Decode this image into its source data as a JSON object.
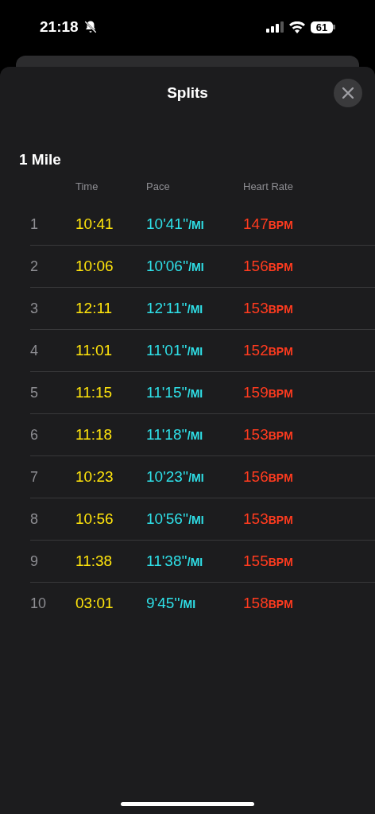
{
  "status_bar": {
    "time": "21:18",
    "battery": "61"
  },
  "sheet": {
    "title": "Splits"
  },
  "section": {
    "title": "1 Mile",
    "columns": [
      "Time",
      "Pace",
      "Heart Rate"
    ]
  },
  "splits": [
    {
      "index": "1",
      "time": "10:41",
      "pace": "10'41''",
      "pace_unit": "/MI",
      "heart_rate": "147",
      "hr_unit": "BPM"
    },
    {
      "index": "2",
      "time": "10:06",
      "pace": "10'06''",
      "pace_unit": "/MI",
      "heart_rate": "156",
      "hr_unit": "BPM"
    },
    {
      "index": "3",
      "time": "12:11",
      "pace": "12'11''",
      "pace_unit": "/MI",
      "heart_rate": "153",
      "hr_unit": "BPM"
    },
    {
      "index": "4",
      "time": "11:01",
      "pace": "11'01''",
      "pace_unit": "/MI",
      "heart_rate": "152",
      "hr_unit": "BPM"
    },
    {
      "index": "5",
      "time": "11:15",
      "pace": "11'15''",
      "pace_unit": "/MI",
      "heart_rate": "159",
      "hr_unit": "BPM"
    },
    {
      "index": "6",
      "time": "11:18",
      "pace": "11'18''",
      "pace_unit": "/MI",
      "heart_rate": "153",
      "hr_unit": "BPM"
    },
    {
      "index": "7",
      "time": "10:23",
      "pace": "10'23''",
      "pace_unit": "/MI",
      "heart_rate": "156",
      "hr_unit": "BPM"
    },
    {
      "index": "8",
      "time": "10:56",
      "pace": "10'56''",
      "pace_unit": "/MI",
      "heart_rate": "153",
      "hr_unit": "BPM"
    },
    {
      "index": "9",
      "time": "11:38",
      "pace": "11'38''",
      "pace_unit": "/MI",
      "heart_rate": "155",
      "hr_unit": "BPM"
    },
    {
      "index": "10",
      "time": "03:01",
      "pace": "9'45''",
      "pace_unit": "/MI",
      "heart_rate": "158",
      "hr_unit": "BPM"
    }
  ]
}
